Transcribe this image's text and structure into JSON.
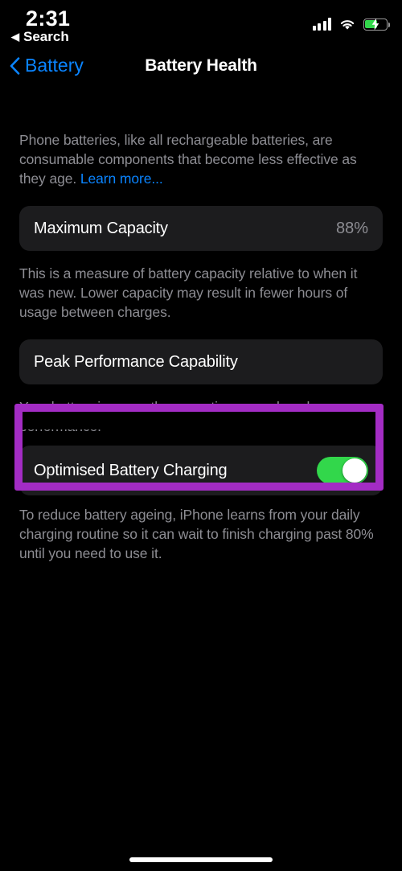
{
  "status_bar": {
    "time": "2:31",
    "back_label": "Search",
    "back_triangle": "◀",
    "signal_icon": "cellular-signal-icon",
    "wifi_icon": "wifi-icon",
    "battery_icon": "battery-charging-icon",
    "battery_level_percent": 55,
    "battery_charging": true,
    "battery_color": "#32d74b"
  },
  "nav": {
    "back_label": "Battery",
    "title": "Battery Health",
    "accent_color": "#0a84ff"
  },
  "intro": {
    "text_before_link": "Phone batteries, like all rechargeable batteries, are consumable components that become less effective as they age. ",
    "link_label": "Learn more..."
  },
  "maximum_capacity": {
    "label": "Maximum Capacity",
    "value": "88%",
    "footnote": "This is a measure of battery capacity relative to when it was new. Lower capacity may result in fewer hours of usage between charges."
  },
  "peak_performance": {
    "label": "Peak Performance Capability",
    "footnote": "Your battery is currently supporting normal peak performance."
  },
  "optimised_charging": {
    "label": "Optimised Battery Charging",
    "toggle_state": "on",
    "toggle_color": "#32d74b",
    "footnote": "To reduce battery ageing, iPhone learns from your daily charging routine so it can wait to finish charging past 80% until you need to use it."
  },
  "annotation": {
    "shape": "rectangle-highlight",
    "color": "#a32cc4",
    "target": "Optimised Battery Charging"
  }
}
